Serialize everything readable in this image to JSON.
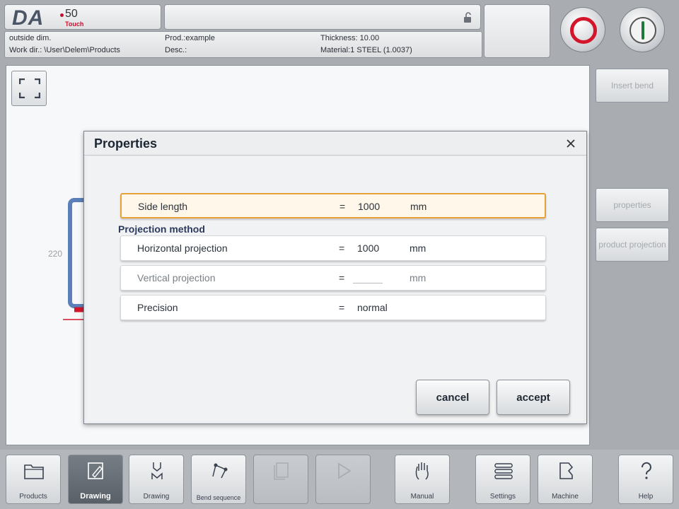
{
  "header": {
    "logo": {
      "brand": "DA",
      "model": "50",
      "variant": "Touch"
    },
    "info": {
      "outside_dim": "outside dim.",
      "workdir": "Work dir.: \\User\\Delem\\Products",
      "prod": "Prod.:example",
      "desc": "Desc.:",
      "thickness": "Thickness: 10.00",
      "material": "Material:1 STEEL (1.0037)"
    },
    "stop_icon": "stop-circle-icon",
    "start_icon": "start-circle-icon"
  },
  "canvas": {
    "dim_label": "220",
    "profile_color": "#5b7fb8",
    "accent_red": "#d4162c"
  },
  "side_buttons": {
    "insert_bend": "Insert bend",
    "properties": "properties",
    "product_projection": "product projection"
  },
  "dialog": {
    "title": "Properties",
    "rows": [
      {
        "label": "Side length",
        "eq": "=",
        "value": "1000",
        "unit": "mm",
        "active": true
      },
      {
        "label": "Horizontal projection",
        "eq": "=",
        "value": "1000",
        "unit": "mm"
      },
      {
        "label": "Vertical projection",
        "eq": "=",
        "value": "",
        "unit": "mm",
        "disabled": true
      },
      {
        "label": "Precision",
        "eq": "=",
        "value": "normal",
        "unit": ""
      }
    ],
    "section_label": "Projection method",
    "cancel": "cancel",
    "accept": "accept",
    "highlight_color": "#e8a23a"
  },
  "nav": [
    {
      "label": "Products",
      "icon": "folder-icon"
    },
    {
      "label": "Drawing",
      "icon": "drawing-pencil-icon",
      "active": true
    },
    {
      "label": "Drawing",
      "icon": "tool-drawing-icon"
    },
    {
      "label": "Bend sequence",
      "icon": "bend-sequence-icon"
    },
    {
      "label": "",
      "icon": "document-stack-icon",
      "disabled": true
    },
    {
      "label": "",
      "icon": "play-icon",
      "disabled": true
    },
    {
      "label": "Manual",
      "icon": "hand-icon"
    },
    {
      "label": "Settings",
      "icon": "settings-list-icon"
    },
    {
      "label": "Machine",
      "icon": "machine-icon"
    },
    {
      "label": "Help",
      "icon": "help-question-icon"
    }
  ]
}
